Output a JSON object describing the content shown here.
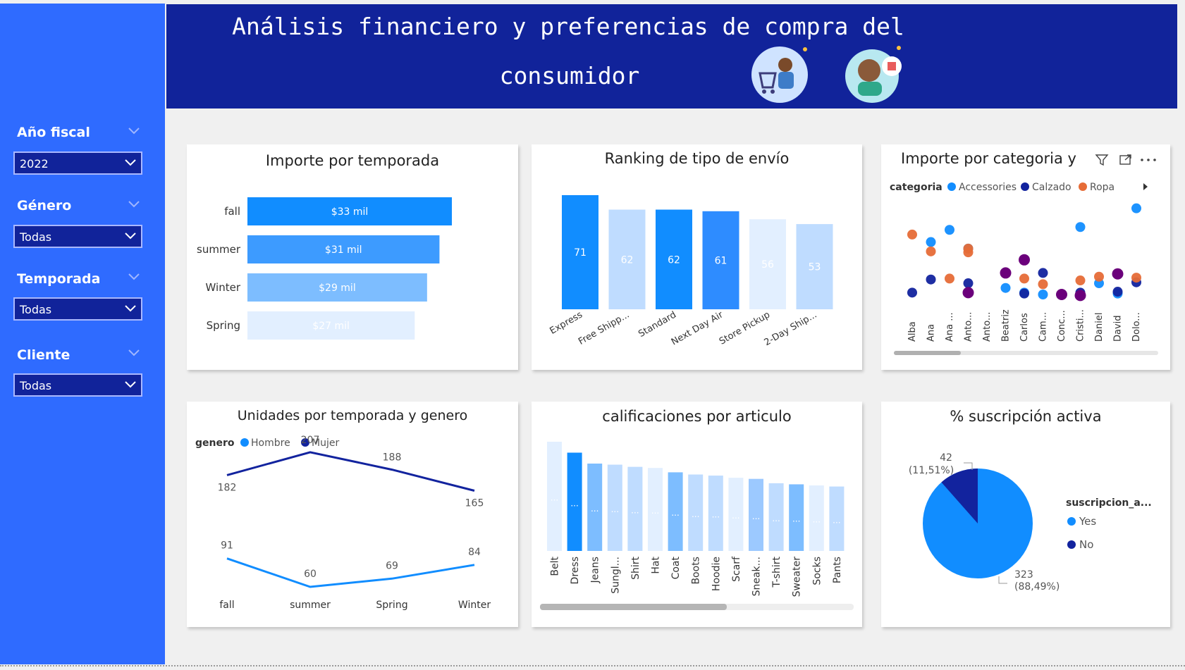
{
  "header": {
    "title_line1": "Análisis financiero y preferencias de compra del",
    "title_line2": "consumidor"
  },
  "sidebar": {
    "slicers": [
      {
        "label": "Año fiscal",
        "value": "2022"
      },
      {
        "label": "Género",
        "value": "Todas"
      },
      {
        "label": "Temporada",
        "value": "Todas"
      },
      {
        "label": "Cliente",
        "value": "Todas"
      }
    ]
  },
  "charts": {
    "importe_temporada": {
      "title": "Importe por temporada"
    },
    "envio": {
      "title": "Ranking de tipo de envío"
    },
    "categoria": {
      "title": "Importe por categoria y",
      "legend_title": "categoria",
      "legend": [
        "Accessories",
        "Calzado",
        "Ropa"
      ]
    },
    "unidades": {
      "title": "Unidades por temporada y genero",
      "legend_title": "genero",
      "legend": [
        "Hombre",
        "Mujer"
      ]
    },
    "calificaciones": {
      "title": "calificaciones por articulo"
    },
    "suscripcion": {
      "title": "% suscripción activa",
      "legend_title": "suscripcion_a...",
      "legend": [
        "Yes",
        "No"
      ]
    }
  },
  "chart_data": [
    {
      "type": "bar",
      "orientation": "horizontal",
      "title": "Importe por temporada",
      "categories": [
        "fall",
        "summer",
        "Winter",
        "Spring"
      ],
      "values": [
        33,
        31,
        29,
        27
      ],
      "labels": [
        "$33 mil",
        "$31 mil",
        "$29 mil",
        "$27 mil"
      ],
      "colors": [
        "#118dff",
        "#3d9bff",
        "#7dbdff",
        "#e2efff"
      ]
    },
    {
      "type": "bar",
      "title": "Ranking de tipo de envío",
      "categories": [
        "Express",
        "Free Shipp...",
        "Standard",
        "Next Day Air",
        "Store Pickup",
        "2-Day Ship..."
      ],
      "values": [
        71,
        62,
        62,
        61,
        56,
        53
      ],
      "colors": [
        "#118dff",
        "#bfdcff",
        "#118dff",
        "#2e8cff",
        "#e2efff",
        "#bfdcff"
      ]
    },
    {
      "type": "scatter",
      "title": "Importe por categoria y",
      "categories": [
        "Alba",
        "Ana",
        "Ana ...",
        "Anto...",
        "Anto...",
        "Beatriz",
        "Carlos",
        "Cam...",
        "Conc...",
        "Cristi...",
        "Daniel",
        "David",
        "Dolo..."
      ],
      "series": [
        {
          "name": "Accessories",
          "color": "#118dff",
          "points": [
            {
              "x": "Ana",
              "y": 59
            },
            {
              "x": "Ana ...",
              "y": 72
            },
            {
              "x": "Anto...",
              "y": 52
            },
            {
              "x": "Beatriz",
              "y": 10
            },
            {
              "x": "Carlos",
              "y": 5
            },
            {
              "x": "Cam...",
              "y": 3
            },
            {
              "x": "Cristi...",
              "y": 75
            },
            {
              "x": "Daniel",
              "y": 15
            },
            {
              "x": "David",
              "y": 4
            },
            {
              "x": "Dolo...",
              "y": 95
            }
          ]
        },
        {
          "name": "Calzado",
          "color": "#12239e",
          "points": [
            {
              "x": "Alba",
              "y": 5
            },
            {
              "x": "Ana",
              "y": 19
            },
            {
              "x": "Anto...",
              "y": 15
            },
            {
              "x": "Carlos",
              "y": 4
            },
            {
              "x": "Cam...",
              "y": 26
            },
            {
              "x": "Cristi...",
              "y": 5
            },
            {
              "x": "David",
              "y": 6
            },
            {
              "x": "Dolo...",
              "y": 16
            }
          ]
        },
        {
          "name": "Ropa",
          "color": "#e66c37",
          "points": [
            {
              "x": "Alba",
              "y": 67
            },
            {
              "x": "Ana",
              "y": 49
            },
            {
              "x": "Ana ...",
              "y": 20
            },
            {
              "x": "Anto...",
              "y": 52
            },
            {
              "x": "Anto...",
              "y": 48
            },
            {
              "x": "Carlos",
              "y": 20
            },
            {
              "x": "Cam...",
              "y": 14
            },
            {
              "x": "Cristi...",
              "y": 18
            },
            {
              "x": "Daniel",
              "y": 22
            },
            {
              "x": "Dolo...",
              "y": 21
            }
          ]
        }
      ],
      "extra_markers": [
        {
          "x": "Beatriz",
          "y": 26,
          "color": "#6b007b"
        },
        {
          "x": "Carlos",
          "y": 40,
          "color": "#6b007b"
        },
        {
          "x": "Anto...",
          "y": 5,
          "color": "#6b007b"
        },
        {
          "x": "Conc...",
          "y": 3,
          "color": "#6b007b"
        },
        {
          "x": "Cristi...",
          "y": 2,
          "color": "#6b007b"
        },
        {
          "x": "David",
          "y": 25,
          "color": "#6b007b"
        }
      ]
    },
    {
      "type": "line",
      "title": "Unidades por temporada y genero",
      "categories": [
        "fall",
        "summer",
        "Spring",
        "Winter"
      ],
      "series": [
        {
          "name": "Hombre",
          "values": [
            91,
            60,
            69,
            84
          ],
          "color": "#118dff"
        },
        {
          "name": "Mujer",
          "values": [
            182,
            207,
            188,
            165
          ],
          "color": "#12239e"
        }
      ]
    },
    {
      "type": "bar",
      "title": "calificaciones por articulo",
      "categories": [
        "Belt",
        "Dress",
        "Jeans",
        "Sungl...",
        "Shirt",
        "Hat",
        "Coat",
        "Boots",
        "Hoodie",
        "Scarf",
        "Sneak...",
        "T-shirt",
        "Sweater",
        "Socks",
        "Pants"
      ],
      "values": [
        100,
        90,
        80,
        79,
        77,
        76,
        72,
        70,
        69,
        67,
        66,
        62,
        61,
        60,
        59
      ],
      "data_label": "...",
      "colors": [
        "#e2efff",
        "#118dff",
        "#7dbdff",
        "#bfdcff",
        "#bfdcff",
        "#e2efff",
        "#7dbdff",
        "#bfdcff",
        "#bfdcff",
        "#e2efff",
        "#9cc9ff",
        "#bfdcff",
        "#7dbdff",
        "#e2efff",
        "#bfdcff"
      ]
    },
    {
      "type": "pie",
      "title": "% suscripción activa",
      "slices": [
        {
          "label": "Yes",
          "value": 323,
          "pct": "(88,49%)",
          "color": "#118dff"
        },
        {
          "label": "No",
          "value": 42,
          "pct": "(11,51%)",
          "color": "#12239e"
        }
      ]
    }
  ]
}
